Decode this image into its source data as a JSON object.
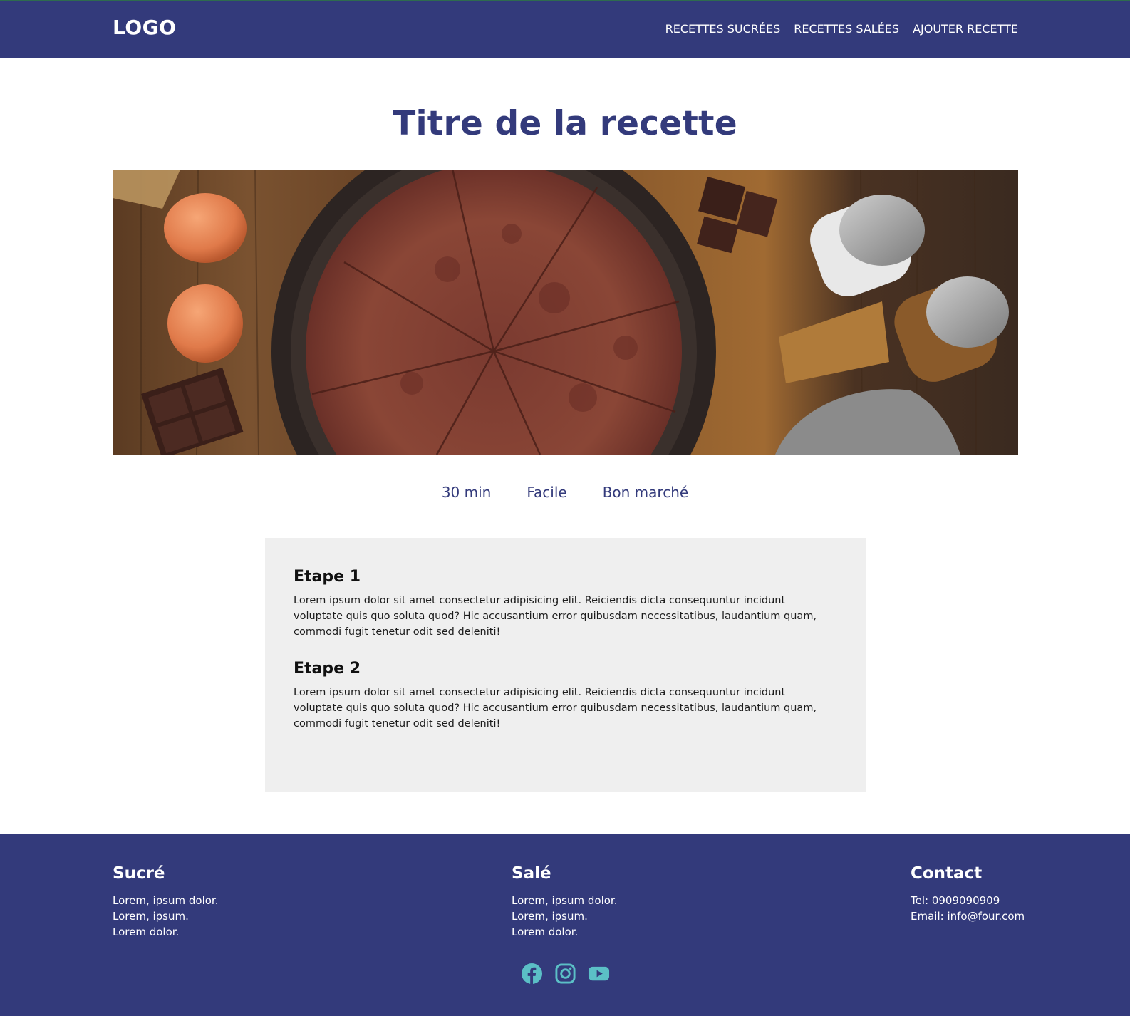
{
  "header": {
    "logo": "LOGO",
    "nav": [
      {
        "label": "RECETTES SUCRÉES"
      },
      {
        "label": "RECETTES SALÉES"
      },
      {
        "label": "AJOUTER RECETTE"
      }
    ]
  },
  "recipe": {
    "title": "Titre de la recette",
    "duration": "30 min",
    "difficulty": "Facile",
    "cost": "Bon marché",
    "steps": [
      {
        "title": "Etape 1",
        "text": "Lorem ipsum dolor sit amet consectetur adipisicing elit. Reiciendis dicta consequuntur incidunt voluptate quis quo soluta quod? Hic accusantium error quibusdam necessitatibus, laudantium quam, commodi fugit tenetur odit sed deleniti!"
      },
      {
        "title": "Etape 2",
        "text": "Lorem ipsum dolor sit amet consectetur adipisicing elit. Reiciendis dicta consequuntur incidunt voluptate quis quo soluta quod? Hic accusantium error quibusdam necessitatibus, laudantium quam, commodi fugit tenetur odit sed deleniti!"
      }
    ]
  },
  "footer": {
    "columns": [
      {
        "title": "Sucré",
        "lines": [
          "Lorem, ipsum dolor.",
          "Lorem, ipsum.",
          "Lorem dolor."
        ]
      },
      {
        "title": "Salé",
        "lines": [
          "Lorem, ipsum dolor.",
          "Lorem, ipsum.",
          "Lorem dolor."
        ]
      },
      {
        "title": "Contact",
        "lines": [
          "Tel: 0909090909",
          "Email: info@four.com"
        ]
      }
    ],
    "socials": [
      {
        "icon": "facebook-icon"
      },
      {
        "icon": "instagram-icon"
      },
      {
        "icon": "youtube-icon"
      }
    ]
  },
  "colors": {
    "primary": "#333a7b",
    "social_icon": "#5bbfc6",
    "steps_background": "#efefef"
  }
}
